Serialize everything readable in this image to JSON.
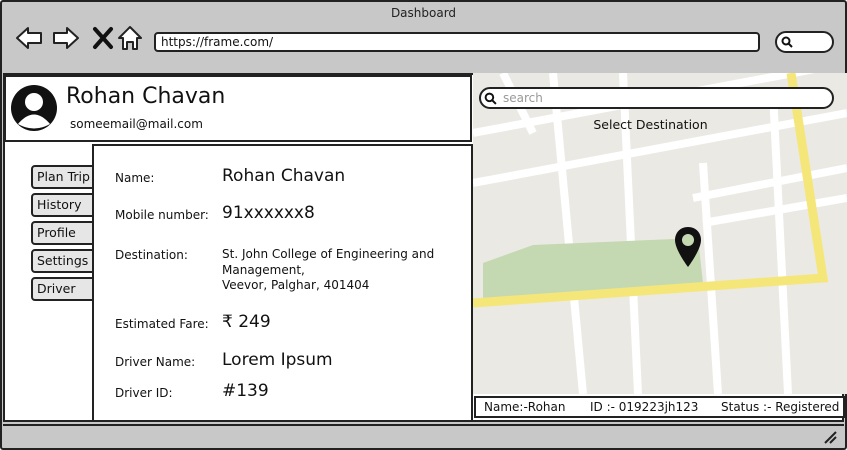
{
  "window": {
    "title": "Dashboard"
  },
  "browser": {
    "url": "https://frame.com/"
  },
  "profile": {
    "name": "Rohan Chavan",
    "email": "someemail@mail.com"
  },
  "tabs": [
    "Plan Trip",
    "History",
    "Profile",
    "Settings",
    "Driver"
  ],
  "details": {
    "name_label": "Name:",
    "name_value": "Rohan Chavan",
    "mobile_label": "Mobile number:",
    "mobile_value": "91xxxxxx8",
    "destination_label": "Destination:",
    "destination_line1": "St. John College of Engineering and",
    "destination_line2": "Management,",
    "destination_line3": "Veevor, Palghar, 401404",
    "fare_label": "Estimated Fare:",
    "fare_value": "₹ 249",
    "driver_name_label": "Driver Name:",
    "driver_name_value": "Lorem Ipsum",
    "driver_id_label": "Driver ID:",
    "driver_id_value": "#139"
  },
  "map": {
    "search_placeholder": "search",
    "caption": "Select Destination"
  },
  "status": {
    "name": "Name:-Rohan",
    "id": "ID :- 019223jh123",
    "state": "Status :- Registered"
  },
  "colors": {
    "chrome": "#c8c8c8",
    "map_bg": "#ebe9e4",
    "road_main": "#f5e67a",
    "park": "#c4d9b1"
  }
}
